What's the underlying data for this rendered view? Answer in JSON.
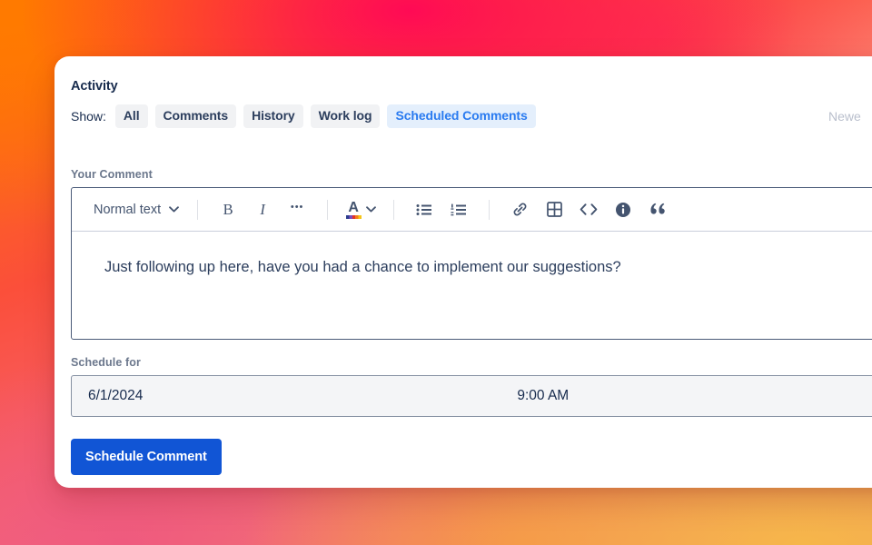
{
  "activity": {
    "title": "Activity",
    "show_label": "Show:",
    "sort_label": "Newe",
    "tabs": [
      {
        "label": "All",
        "active": false
      },
      {
        "label": "Comments",
        "active": false
      },
      {
        "label": "History",
        "active": false
      },
      {
        "label": "Work log",
        "active": false
      },
      {
        "label": "Scheduled Comments",
        "active": true
      }
    ]
  },
  "comment": {
    "field_label": "Your Comment",
    "body_text": "Just following up here, have you had a chance to implement our suggestions?",
    "toolbar": {
      "style_label": "Normal text",
      "style_chevron": "chevron-down-icon",
      "bold": "B",
      "italic": "I",
      "more": "•••",
      "text_color": "A",
      "text_color_chevron": "chevron-down-icon",
      "bullet_list": "bullet-list-icon",
      "numbered_list": "numbered-list-icon",
      "link": "link-icon",
      "table": "table-icon",
      "code": "code-icon",
      "info": "info-icon",
      "quote": "quote-icon"
    }
  },
  "schedule": {
    "field_label": "Schedule for",
    "date": "6/1/2024",
    "time": "9:00 AM"
  },
  "submit": {
    "label": "Schedule Comment"
  },
  "colors": {
    "primary_blue": "#1155d5",
    "active_tab_text": "#2a7bf0",
    "active_tab_bg": "#e4effc",
    "pill_bg": "#f1f2f4",
    "text_navy": "#172b4d",
    "label_gray": "#6b778c"
  }
}
